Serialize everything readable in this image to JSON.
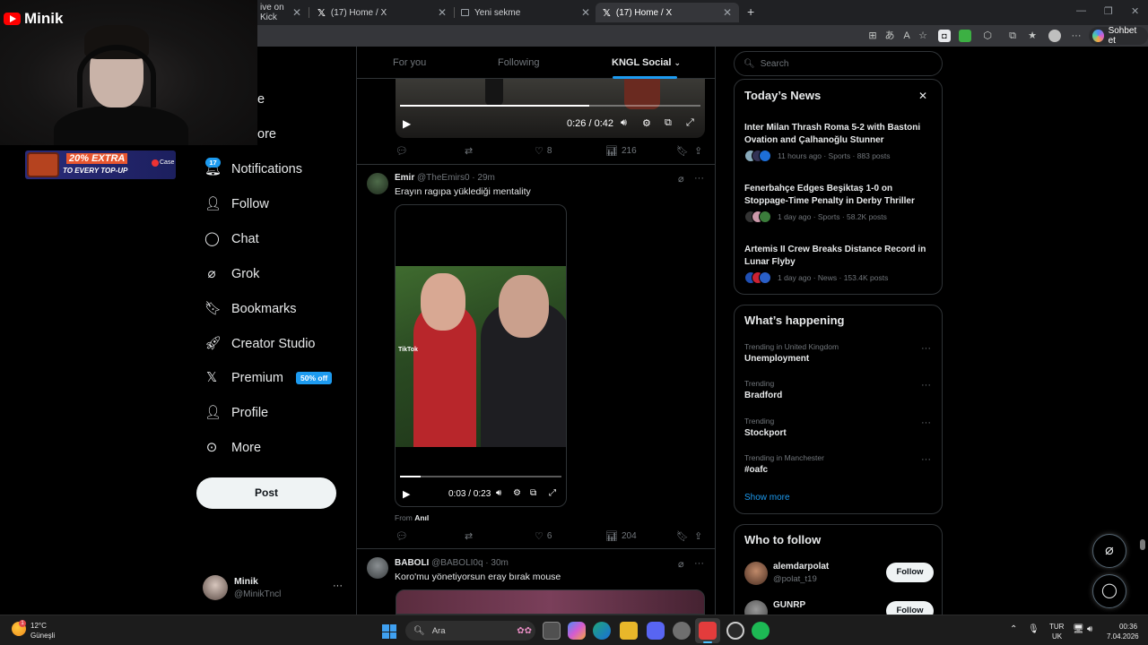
{
  "browser": {
    "tabs": [
      {
        "label": "ive on Kick"
      },
      {
        "label": "(17) Home / X"
      },
      {
        "label": "Yeni sekme"
      },
      {
        "label": "(17) Home / X"
      }
    ],
    "copilot_label": "Sohbet et",
    "window_controls": {
      "minimize": "—",
      "restore": "❐",
      "close": "✕"
    }
  },
  "overlay": {
    "channel_name": "Minik",
    "promo": {
      "headline": "20% EXTRA",
      "subline": "TO EVERY TOP-UP",
      "brand": "Case"
    }
  },
  "sidebar": {
    "partial_items": [
      "e",
      "ore"
    ],
    "notifications_badge": "17",
    "items": [
      {
        "label": "Notifications",
        "icon": "bell-icon"
      },
      {
        "label": "Follow",
        "icon": "person-plus-icon"
      },
      {
        "label": "Chat",
        "icon": "chat-icon"
      },
      {
        "label": "Grok",
        "icon": "grok-icon"
      },
      {
        "label": "Bookmarks",
        "icon": "bookmark-icon"
      },
      {
        "label": "Creator Studio",
        "icon": "rocket-icon"
      },
      {
        "label": "Premium",
        "icon": "x-logo-icon"
      },
      {
        "label": "Profile",
        "icon": "person-icon"
      },
      {
        "label": "More",
        "icon": "more-circle-icon"
      }
    ],
    "premium_badge": "50% off",
    "post_button": "Post",
    "account": {
      "name": "Minik",
      "handle": "@MinikTncl"
    }
  },
  "feed": {
    "tabs": [
      "For you",
      "Following",
      "KNGL Social"
    ],
    "video1": {
      "time": "0:26 / 0:42",
      "progress": 0.63
    },
    "post1_stats": {
      "likes": "8",
      "views": "216"
    },
    "post2": {
      "name": "Emir",
      "handle": "@TheEmirs0",
      "time": "29m",
      "text": "Erayın ragıpa yüklediği mentality",
      "video_time": "0:03 / 0:23",
      "video_progress": 0.13,
      "tiktok_label": "TikTok",
      "from_label": "From",
      "from_name": "Anıl",
      "likes": "6",
      "views": "204"
    },
    "post3": {
      "name": "BABOLI",
      "handle": "@BABOLI0q",
      "time": "30m",
      "text": "Koro'mu yönetiyorsun eray bırak mouse"
    }
  },
  "right": {
    "search_placeholder": "Search",
    "news": {
      "title": "Today’s News",
      "items": [
        {
          "title": "Inter Milan Thrash Roma 5-2 with Bastoni Ovation and Çalhanoğlu Stunner",
          "meta": "11 hours ago · Sports · 883 posts"
        },
        {
          "title": "Fenerbahçe Edges Beşiktaş 1-0 on Stoppage-Time Penalty in Derby Thriller",
          "meta": "1 day ago · Sports · 58.2K posts"
        },
        {
          "title": "Artemis II Crew Breaks Distance Record in Lunar Flyby",
          "meta": "1 day ago · News · 153.4K posts"
        }
      ]
    },
    "happening": {
      "title": "What’s happening",
      "trends": [
        {
          "context": "Trending in United Kingdom",
          "name": "Unemployment"
        },
        {
          "context": "Trending",
          "name": "Bradford"
        },
        {
          "context": "Trending",
          "name": "Stockport"
        },
        {
          "context": "Trending in Manchester",
          "name": "#oafc"
        }
      ],
      "show_more": "Show more"
    },
    "who_to_follow": {
      "title": "Who to follow",
      "accounts": [
        {
          "name": "alemdarpolat",
          "handle": "@polat_t19",
          "button": "Follow"
        },
        {
          "name": "GUNRP",
          "handle": "",
          "button": "Follow"
        }
      ]
    }
  },
  "taskbar": {
    "temperature": "12°C",
    "condition": "Güneşli",
    "search_label": "Ara",
    "language": "TUR",
    "layout": "UK",
    "time": "00:36",
    "date": "7.04.2026"
  }
}
